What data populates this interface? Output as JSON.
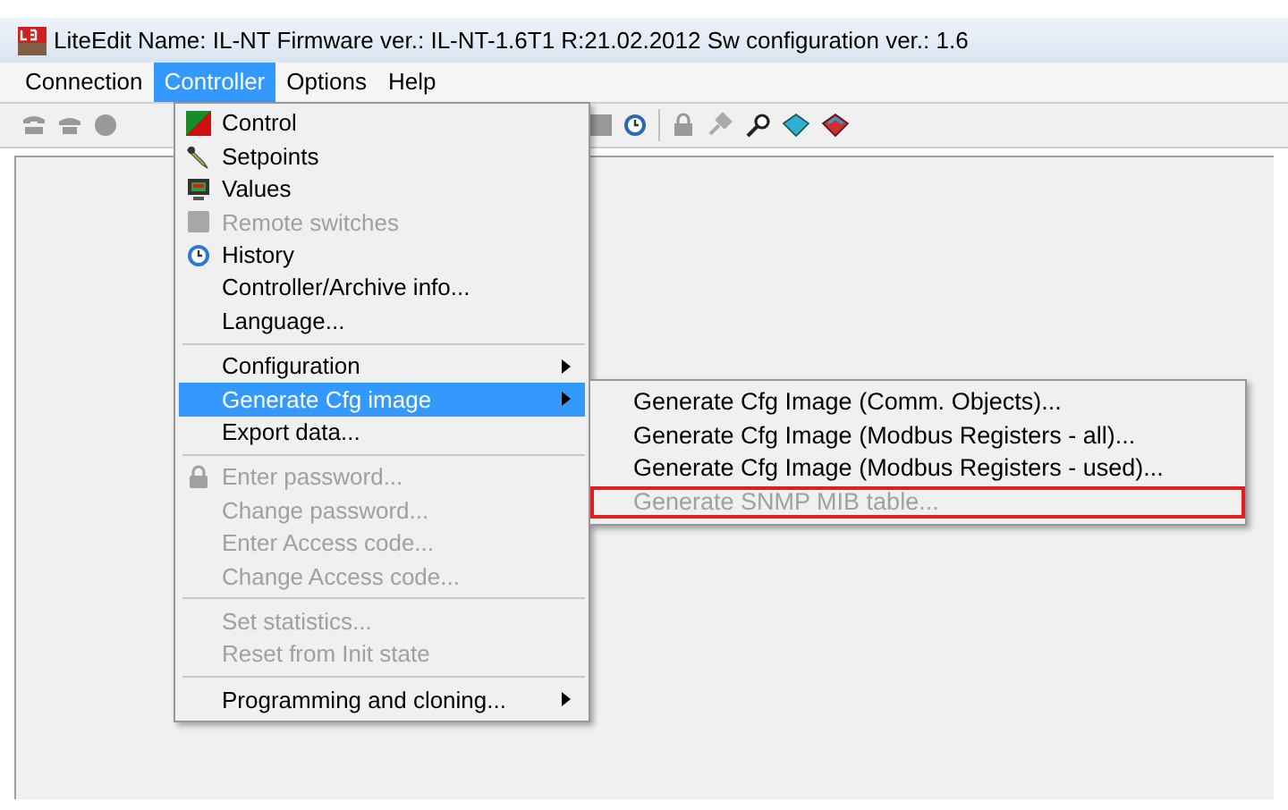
{
  "window": {
    "title": "LiteEdit Name: IL-NT Firmware ver.: IL-NT-1.6T1 R:21.02.2012 Sw configuration ver.: 1.6"
  },
  "menu_bar": [
    {
      "label": "Connection",
      "selected": false
    },
    {
      "label": "Controller",
      "selected": true
    },
    {
      "label": "Options",
      "selected": false
    },
    {
      "label": "Help",
      "selected": false
    }
  ],
  "controller_menu": [
    {
      "kind": "item",
      "label": "Control",
      "disabled": false,
      "selected": false,
      "submenu": false
    },
    {
      "kind": "item",
      "label": "Setpoints",
      "disabled": false,
      "selected": false,
      "submenu": false
    },
    {
      "kind": "item",
      "label": "Values",
      "disabled": false,
      "selected": false,
      "submenu": false
    },
    {
      "kind": "item",
      "label": "Remote switches",
      "disabled": true,
      "selected": false,
      "submenu": false
    },
    {
      "kind": "item",
      "label": "History",
      "disabled": false,
      "selected": false,
      "submenu": false
    },
    {
      "kind": "item",
      "label": "Controller/Archive info...",
      "disabled": false,
      "selected": false,
      "submenu": false
    },
    {
      "kind": "item",
      "label": "Language...",
      "disabled": false,
      "selected": false,
      "submenu": false
    },
    {
      "kind": "separator"
    },
    {
      "kind": "item",
      "label": "Configuration",
      "disabled": false,
      "selected": false,
      "submenu": true
    },
    {
      "kind": "item",
      "label": "Generate Cfg image",
      "disabled": false,
      "selected": true,
      "submenu": true
    },
    {
      "kind": "item",
      "label": "Export data...",
      "disabled": false,
      "selected": false,
      "submenu": false
    },
    {
      "kind": "separator"
    },
    {
      "kind": "item",
      "label": "Enter password...",
      "disabled": true,
      "selected": false,
      "submenu": false
    },
    {
      "kind": "item",
      "label": "Change password...",
      "disabled": true,
      "selected": false,
      "submenu": false
    },
    {
      "kind": "item",
      "label": "Enter Access code...",
      "disabled": true,
      "selected": false,
      "submenu": false
    },
    {
      "kind": "item",
      "label": "Change Access code...",
      "disabled": true,
      "selected": false,
      "submenu": false
    },
    {
      "kind": "separator"
    },
    {
      "kind": "item",
      "label": "Set statistics...",
      "disabled": true,
      "selected": false,
      "submenu": false
    },
    {
      "kind": "item",
      "label": "Reset from Init state",
      "disabled": true,
      "selected": false,
      "submenu": false
    },
    {
      "kind": "separator"
    },
    {
      "kind": "item",
      "label": "Programming and cloning...",
      "disabled": false,
      "selected": false,
      "submenu": true
    }
  ],
  "cfg_image_submenu": [
    {
      "label": "Generate Cfg Image (Comm. Objects)...",
      "disabled": false,
      "highlighted": false
    },
    {
      "label": "Generate Cfg Image (Modbus Registers - all)...",
      "disabled": false,
      "highlighted": false
    },
    {
      "label": "Generate Cfg Image (Modbus Registers - used)...",
      "disabled": false,
      "highlighted": false
    },
    {
      "label": "Generate SNMP MIB table...",
      "disabled": true,
      "highlighted": true
    }
  ]
}
